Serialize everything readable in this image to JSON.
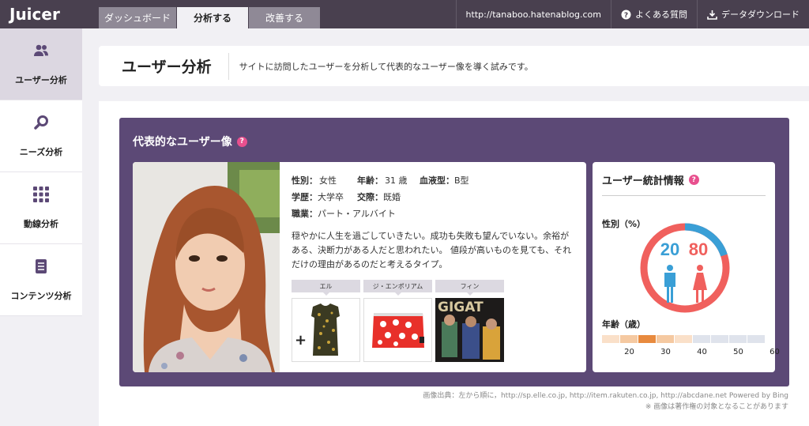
{
  "app": {
    "logo": "Juicer"
  },
  "nav": {
    "tabs": [
      {
        "label": "ダッシュボード"
      },
      {
        "label": "分析する"
      },
      {
        "label": "改善する"
      }
    ]
  },
  "top": {
    "site": "http://tanaboo.hatenablog.com",
    "faq": "よくある質問",
    "download": "データダウンロード"
  },
  "sidebar": {
    "items": [
      {
        "label": "ユーザー分析",
        "icon": "users-icon"
      },
      {
        "label": "ニーズ分析",
        "icon": "search-icon"
      },
      {
        "label": "動線分析",
        "icon": "grid-icon"
      },
      {
        "label": "コンテンツ分析",
        "icon": "document-icon"
      }
    ]
  },
  "header": {
    "title": "ユーザー分析",
    "desc": "サイトに訪問したユーザーを分析して代表的なユーザー像を導く試みです。"
  },
  "persona": {
    "title": "代表的なユーザー像",
    "gender_label": "性別：",
    "gender": "女性",
    "age_label": "年齢：",
    "age": "31 歳",
    "blood_label": "血液型：",
    "blood": "B型",
    "edu_label": "学歴：",
    "edu": "大学卒",
    "rel_label": "交際：",
    "rel": "既婚",
    "job_label": "職業：",
    "job": "パート・アルバイト",
    "desc": "穏やかに人生を過ごしていきたい。成功も失敗も望んでいない。余裕がある、決断力がある人だと思われたい。 値段が高いものを見ても、それだけの理由があるのだと考えるタイプ。",
    "items": [
      {
        "label": "エル"
      },
      {
        "label": "ジ・エンポリアム"
      },
      {
        "label": "フィン"
      }
    ],
    "magazine_text": "GIGAT"
  },
  "stats": {
    "title": "ユーザー統計情報",
    "gender_label": "性別（%）",
    "male": "20",
    "female": "80",
    "male_pct": 20,
    "female_pct": 80,
    "male_color": "#3a9fd6",
    "female_color": "#f0605d",
    "age_label": "年齢（歳）",
    "age_ticks": [
      "20",
      "30",
      "40",
      "50",
      "60"
    ],
    "age_colors": [
      "#fae0c9",
      "#f5c9a1",
      "#e88a3e",
      "#f5c9a1",
      "#fae0c9",
      "#dfe3ec",
      "#dfe3ec",
      "#dfe3ec",
      "#dfe3ec"
    ]
  },
  "credit": {
    "line1": "画像出典：左から順に，http://sp.elle.co.jp, http://item.rakuten.co.jp, http://abcdane.net Powered by Bing",
    "line2": "※ 画像は著作権の対象となることがあります"
  }
}
